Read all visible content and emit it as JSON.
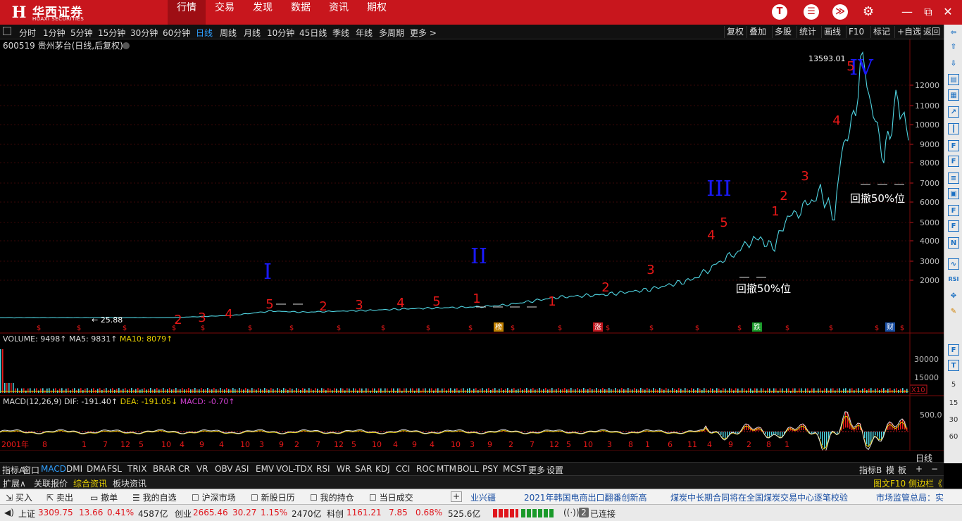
{
  "brand": {
    "name_cn": "华西证券",
    "name_en": "HUAXI SECURITIES",
    "mark": "H"
  },
  "nav": [
    "行情",
    "交易",
    "发现",
    "数据",
    "资讯",
    "期权"
  ],
  "nav_active": "行情",
  "top_icons": [
    "T",
    "☰",
    "≫",
    "⚙"
  ],
  "window_controls": [
    "—",
    "⧉",
    "✕"
  ],
  "periods": [
    "分时",
    "1分钟",
    "5分钟",
    "15分钟",
    "30分钟",
    "60分钟",
    "日线",
    "周线",
    "月线",
    "10分钟",
    "45日线",
    "季线",
    "年线",
    "多周期",
    "更多 >"
  ],
  "period_active": "日线",
  "toolbar_right": [
    "复权",
    "叠加",
    "多股",
    "统计",
    "画线",
    "F10",
    "标记",
    "+自选",
    "返回"
  ],
  "stock": {
    "title": "600519 贵州茅台(日线,后复权)"
  },
  "chart_data": {
    "type": "line",
    "title": "600519 贵州茅台(日线,后复权)",
    "y_axis": {
      "ticks": [
        2000,
        3000,
        4000,
        5000,
        6000,
        7000,
        8000,
        9000,
        10000,
        11000,
        12000
      ],
      "tick_labels": [
        "2000",
        "3000",
        "4000",
        "5000",
        "6000",
        "7000",
        "8000",
        "9000",
        "10000",
        "11000",
        "12000"
      ]
    },
    "x_axis": {
      "tick_labels": [
        "2001年",
        "8",
        "1",
        "7",
        "12",
        "5",
        "10",
        "4",
        "9",
        "4",
        "10",
        "3",
        "9",
        "2",
        "7",
        "12",
        "5",
        "10",
        "4",
        "9",
        "4",
        "10",
        "3",
        "9",
        "2",
        "7",
        "12",
        "5",
        "10",
        "3",
        "8",
        "1",
        "6",
        "11",
        "4",
        "9",
        "2",
        "8",
        "1"
      ]
    },
    "series": [
      {
        "values": [
          25.88,
          30,
          80,
          150,
          380,
          320,
          360,
          410,
          500,
          560,
          600,
          700,
          1100,
          1250,
          1500,
          2000,
          2500,
          2950,
          3400,
          4100,
          4000,
          3700,
          5100,
          5700,
          6500,
          5300,
          8500,
          10800,
          13593,
          10600,
          8300,
          11500,
          9200
        ]
      }
    ],
    "max_label": "13593.01",
    "min_label": "← 25.88",
    "wave_labels": {
      "roman": [
        "I",
        "II",
        "III",
        "IV"
      ],
      "counts": [
        "2",
        "3",
        "4",
        "5",
        "1",
        "2",
        "3",
        "4",
        "5",
        "1",
        "2",
        "3",
        "4",
        "5",
        "1",
        "2",
        "3",
        "4",
        "5"
      ],
      "retrace": [
        "回撤50%位",
        "回撤50%位"
      ]
    },
    "event_markers": [
      "$",
      "$",
      "$",
      "$",
      "$",
      "$",
      "$",
      "$",
      "$",
      "$",
      "$",
      "$",
      "$",
      "$",
      "$",
      "$",
      "$",
      "$",
      "$",
      "$",
      "$",
      "$",
      "$",
      "$"
    ],
    "event_badges": [
      "榜",
      "涨",
      "跌",
      "财"
    ],
    "volume": {
      "label": "VOLUME: 9498↑",
      "ma5": "MA5: 9831↑",
      "ma10": "MA10: 8079↑",
      "ticks": [
        "30000",
        "15000"
      ],
      "scale": "X10"
    },
    "macd": {
      "label": "MACD(12,26,9)",
      "dif": "DIF: -191.40↑",
      "dea": "DEA: -191.05↓",
      "macd": "MACD: -0.70↑",
      "ticks": [
        "500.0"
      ]
    }
  },
  "right_side_numbers": [
    "5",
    "15",
    "30",
    "60"
  ],
  "indicator_tabs": [
    "指标A",
    "窗口",
    "MACD",
    "DMI",
    "DMA",
    "FSL",
    "TRIX",
    "BRAR",
    "CR",
    "VR",
    "OBV",
    "ASI",
    "EMV",
    "VOL-TDX",
    "RSI",
    "WR",
    "SAR",
    "KDJ",
    "CCI",
    "ROC",
    "MTM",
    "BOLL",
    "PSY",
    "MCST",
    "更多",
    "设置"
  ],
  "indicator_active": "MACD",
  "indicator_right": [
    "指标B",
    "模",
    "板",
    "+",
    "−"
  ],
  "period_label": "日线",
  "ext_tabs": [
    "扩展∧",
    "关联报价",
    "综合资讯",
    "板块资讯"
  ],
  "ext_right": "图文F10 侧边栏《",
  "trade_buttons": [
    "买入",
    "卖出",
    "撤单",
    "我的自选",
    "沪深市场",
    "新股日历",
    "我的持仓",
    "当日成交"
  ],
  "news": [
    "业兴疆",
    "2021年韩国电商出口翻番创新高",
    "煤炭中长期合同将在全国煤炭交易中心逐笔校验",
    "市场监管总局：实"
  ],
  "status": {
    "sh_name": "上证",
    "sh_val": "3309.75",
    "sh_chg": "13.66",
    "sh_pct": "0.41%",
    "sh_amt": "4587亿",
    "cy_name": "创业",
    "cy_val": "2665.46",
    "cy_chg": "30.27",
    "cy_pct": "1.15%",
    "cy_amt": "2470亿",
    "kc_name": "科创",
    "kc_val": "1161.21",
    "kc_chg": "7.85",
    "kc_pct": "0.68%",
    "kc_amt": "525.6亿",
    "conn": "已连接",
    "conn_num": "2"
  }
}
